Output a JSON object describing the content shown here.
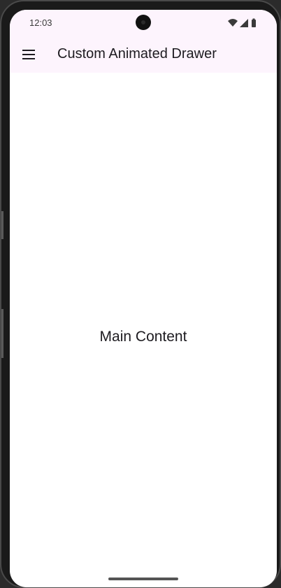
{
  "status_bar": {
    "time": "12:03",
    "icons": [
      "wifi-icon",
      "signal-icon",
      "battery-icon"
    ]
  },
  "app_bar": {
    "menu_icon": "menu-icon",
    "title": "Custom Animated Drawer"
  },
  "main": {
    "text": "Main Content"
  },
  "colors": {
    "app_bar_background": "#fdf4fd",
    "text": "#1d1b20",
    "screen_background": "#ffffff"
  }
}
